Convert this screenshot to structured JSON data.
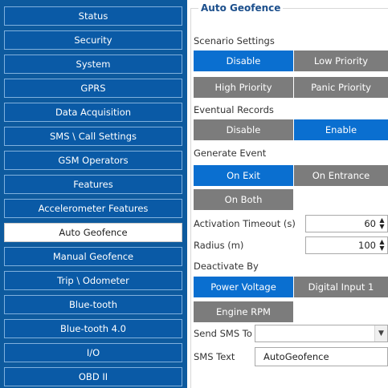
{
  "sidebar": {
    "items": [
      {
        "label": "Status"
      },
      {
        "label": "Security"
      },
      {
        "label": "System"
      },
      {
        "label": "GPRS"
      },
      {
        "label": "Data Acquisition"
      },
      {
        "label": "SMS \\ Call Settings"
      },
      {
        "label": "GSM Operators"
      },
      {
        "label": "Features"
      },
      {
        "label": "Accelerometer Features"
      },
      {
        "label": "Auto Geofence"
      },
      {
        "label": "Manual Geofence"
      },
      {
        "label": "Trip \\ Odometer"
      },
      {
        "label": "Blue-tooth"
      },
      {
        "label": "Blue-tooth 4.0"
      },
      {
        "label": "I/O"
      },
      {
        "label": "OBD II"
      }
    ],
    "active_item": "Auto Geofence"
  },
  "panel": {
    "title": "Auto Geofence",
    "scenario": {
      "label": "Scenario Settings",
      "options": [
        "Disable",
        "Low Priority",
        "High Priority",
        "Panic Priority"
      ],
      "selected": "Disable"
    },
    "eventual": {
      "label": "Eventual Records",
      "options": [
        "Disable",
        "Enable"
      ],
      "selected": "Enable"
    },
    "generate": {
      "label": "Generate Event",
      "options": [
        "On Exit",
        "On Entrance",
        "On Both"
      ],
      "selected": "On Exit"
    },
    "activation": {
      "label": "Activation Timeout (s)",
      "value": "60"
    },
    "radius": {
      "label": "Radius (m)",
      "value": "100"
    },
    "deactivate": {
      "label": "Deactivate By",
      "options": [
        "Power Voltage",
        "Digital Input 1",
        "Engine RPM"
      ],
      "selected": "Power Voltage"
    },
    "send_sms": {
      "label": "Send SMS To",
      "value": ""
    },
    "sms_text": {
      "label": "SMS Text",
      "value": "AutoGeofence"
    }
  },
  "colors": {
    "sidebar_bg": "#0d5a9e",
    "selected": "#0a6fd0",
    "unselected": "#7c7c7c",
    "title": "#1c4f8c"
  }
}
